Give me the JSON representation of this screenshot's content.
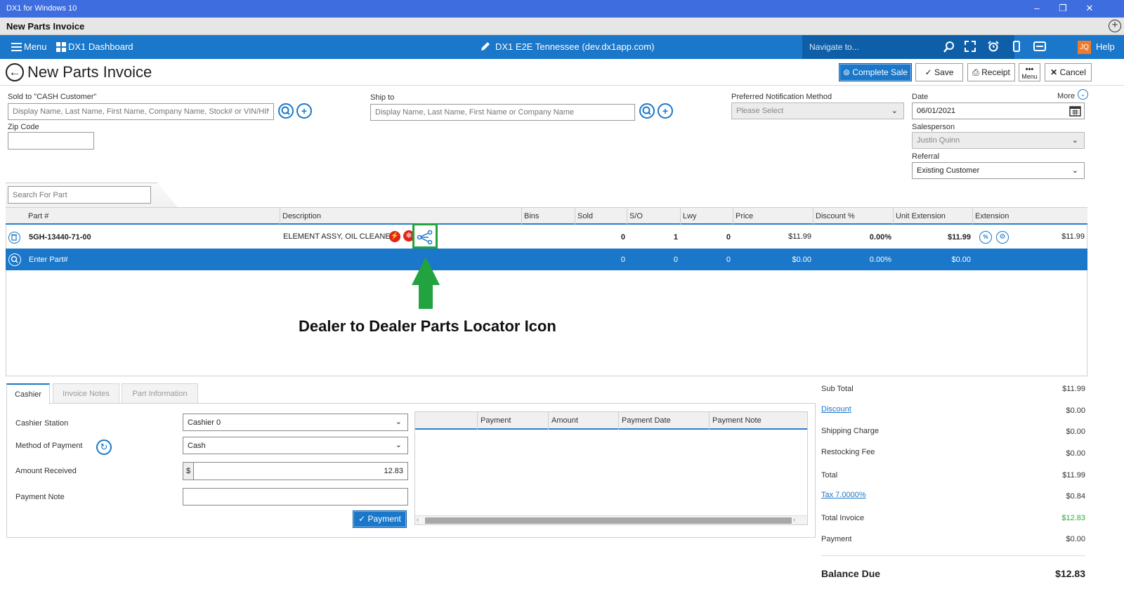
{
  "window": {
    "title": "DX1 for Windows 10",
    "minimize": "–",
    "restore": "❐",
    "close": "✕"
  },
  "doc_tab": {
    "title": "New Parts Invoice",
    "add": "+"
  },
  "nav": {
    "menu_label": "Menu",
    "dashboard_label": "DX1 Dashboard",
    "company": "DX1 E2E Tennessee (dev.dx1app.com)",
    "search_placeholder": "Navigate to...",
    "avatar_initials": "JQ",
    "help_label": "Help"
  },
  "header": {
    "title": "New Parts Invoice",
    "buttons": {
      "complete_sale": "Complete Sale",
      "save": "Save",
      "receipt": "Receipt",
      "menu": "Menu",
      "cancel": "Cancel"
    }
  },
  "form": {
    "sold_to_label": "Sold to  \"CASH Customer\"",
    "sold_to_placeholder": "Display Name, Last Name, First Name, Company Name, Stock# or VIN/HIN",
    "zip_label": "Zip Code",
    "ship_to_label": "Ship to",
    "ship_to_placeholder": "Display Name, Last Name, First Name or Company Name",
    "notification_label": "Preferred Notification Method",
    "notification_value": "Please Select",
    "date_label": "Date",
    "date_value": "06/01/2021",
    "more_label": "More",
    "salesperson_label": "Salesperson",
    "salesperson_value": "Justin Quinn",
    "referral_label": "Referral",
    "referral_value": "Existing Customer"
  },
  "parts": {
    "search_placeholder": "Search For Part",
    "columns": [
      "Part #",
      "Description",
      "Bins",
      "Sold",
      "S/O",
      "Lwy",
      "Price",
      "Discount %",
      "Unit Extension",
      "Extension"
    ],
    "row": {
      "part": "5GH-13440-71-00",
      "description": "ELEMENT ASSY, OIL CLEANER",
      "sold": "0",
      "so": "1",
      "lwy": "0",
      "price": "$11.99",
      "discount": "0.00%",
      "unit_extension": "$11.99",
      "extension": "$11.99"
    },
    "enter_row": {
      "label": "Enter Part#",
      "sold": "0",
      "so": "0",
      "lwy": "0",
      "price": "$0.00",
      "discount": "0.00%",
      "unit_extension": "$0.00"
    }
  },
  "annotation": {
    "text": "Dealer to Dealer Parts Locator Icon",
    "color": "#23a33f"
  },
  "bottom_tabs": [
    "Cashier",
    "Invoice Notes",
    "Part Information"
  ],
  "cashier": {
    "station_label": "Cashier Station",
    "station_value": "Cashier 0",
    "method_label": "Method of Payment",
    "method_value": "Cash",
    "amount_label": "Amount Received",
    "currency": "$",
    "amount_value": "12.83",
    "note_label": "Payment Note",
    "payment_button": "Payment",
    "grid_columns": [
      "Payment",
      "Amount",
      "Payment Date",
      "Payment Note"
    ]
  },
  "totals": {
    "sub_total_label": "Sub Total",
    "sub_total": "$11.99",
    "discount_label": "Discount",
    "discount": "$0.00",
    "shipping_label": "Shipping Charge",
    "shipping": "$0.00",
    "restocking_label": "Restocking Fee",
    "restocking": "$0.00",
    "total_label": "Total",
    "total": "$11.99",
    "tax_label": "Tax 7.0000%",
    "tax": "$0.84",
    "total_invoice_label": "Total Invoice",
    "total_invoice": "$12.83",
    "payment_label": "Payment",
    "payment": "$0.00",
    "balance_due_label": "Balance Due",
    "balance_due": "$12.83"
  },
  "colors": {
    "titlebar": "#3e6de0",
    "nav": "#1a77c9",
    "accent": "#1a77c9",
    "green_total": "#2eaa3a"
  }
}
